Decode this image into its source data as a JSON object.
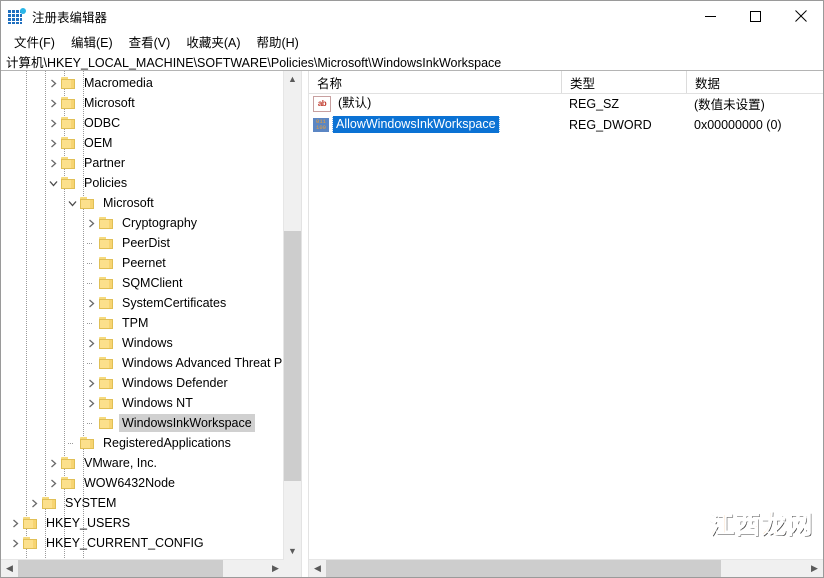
{
  "window": {
    "title": "注册表编辑器",
    "app_icon": "registry-editor-icon",
    "buttons": {
      "minimize": "–",
      "maximize": "□",
      "close": "✕"
    }
  },
  "menubar": {
    "items": [
      {
        "label": "文件(F)",
        "name": "menu-file"
      },
      {
        "label": "编辑(E)",
        "name": "menu-edit"
      },
      {
        "label": "查看(V)",
        "name": "menu-view"
      },
      {
        "label": "收藏夹(A)",
        "name": "menu-favorites"
      },
      {
        "label": "帮助(H)",
        "name": "menu-help"
      }
    ]
  },
  "address": {
    "path": "计算机\\HKEY_LOCAL_MACHINE\\SOFTWARE\\Policies\\Microsoft\\WindowsInkWorkspace"
  },
  "tree": {
    "items": [
      {
        "label": "Macromedia",
        "depth": 3,
        "expander": "collapsed",
        "selected": false
      },
      {
        "label": "Microsoft",
        "depth": 3,
        "expander": "collapsed",
        "selected": false
      },
      {
        "label": "ODBC",
        "depth": 3,
        "expander": "collapsed",
        "selected": false
      },
      {
        "label": "OEM",
        "depth": 3,
        "expander": "collapsed",
        "selected": false
      },
      {
        "label": "Partner",
        "depth": 3,
        "expander": "collapsed",
        "selected": false
      },
      {
        "label": "Policies",
        "depth": 3,
        "expander": "expanded",
        "selected": false
      },
      {
        "label": "Microsoft",
        "depth": 4,
        "expander": "expanded",
        "selected": false
      },
      {
        "label": "Cryptography",
        "depth": 5,
        "expander": "collapsed",
        "selected": false
      },
      {
        "label": "PeerDist",
        "depth": 5,
        "expander": "none",
        "selected": false
      },
      {
        "label": "Peernet",
        "depth": 5,
        "expander": "none",
        "selected": false
      },
      {
        "label": "SQMClient",
        "depth": 5,
        "expander": "none",
        "selected": false
      },
      {
        "label": "SystemCertificates",
        "depth": 5,
        "expander": "collapsed",
        "selected": false
      },
      {
        "label": "TPM",
        "depth": 5,
        "expander": "none",
        "selected": false
      },
      {
        "label": "Windows",
        "depth": 5,
        "expander": "collapsed",
        "selected": false
      },
      {
        "label": "Windows Advanced Threat P",
        "depth": 5,
        "expander": "none",
        "selected": false
      },
      {
        "label": "Windows Defender",
        "depth": 5,
        "expander": "collapsed",
        "selected": false
      },
      {
        "label": "Windows NT",
        "depth": 5,
        "expander": "collapsed",
        "selected": false
      },
      {
        "label": "WindowsInkWorkspace",
        "depth": 5,
        "expander": "none",
        "selected": true
      },
      {
        "label": "RegisteredApplications",
        "depth": 4,
        "expander": "none",
        "selected": false
      },
      {
        "label": "VMware, Inc.",
        "depth": 3,
        "expander": "collapsed",
        "selected": false
      },
      {
        "label": "WOW6432Node",
        "depth": 3,
        "expander": "collapsed",
        "selected": false
      },
      {
        "label": "SYSTEM",
        "depth": 2,
        "expander": "collapsed",
        "selected": false
      },
      {
        "label": "HKEY_USERS",
        "depth": 1,
        "expander": "collapsed",
        "selected": false
      },
      {
        "label": "HKEY_CURRENT_CONFIG",
        "depth": 1,
        "expander": "collapsed",
        "selected": false
      }
    ]
  },
  "list": {
    "columns": [
      {
        "label": "名称",
        "name": "column-name"
      },
      {
        "label": "类型",
        "name": "column-type"
      },
      {
        "label": "数据",
        "name": "column-data"
      }
    ],
    "rows": [
      {
        "name": "(默认)",
        "type": "REG_SZ",
        "data": "(数值未设置)",
        "icon": "string-value-icon",
        "selected": false
      },
      {
        "name": "AllowWindowsInkWorkspace",
        "type": "REG_DWORD",
        "data": "0x00000000 (0)",
        "icon": "dword-value-icon",
        "selected": true
      }
    ]
  },
  "watermark": {
    "text": "江西龙网"
  },
  "colors": {
    "selection_blue": "#0b72d4",
    "selection_gray": "#d0d0d0",
    "folder": "#fce08c",
    "watermark": "#f08a1e"
  }
}
